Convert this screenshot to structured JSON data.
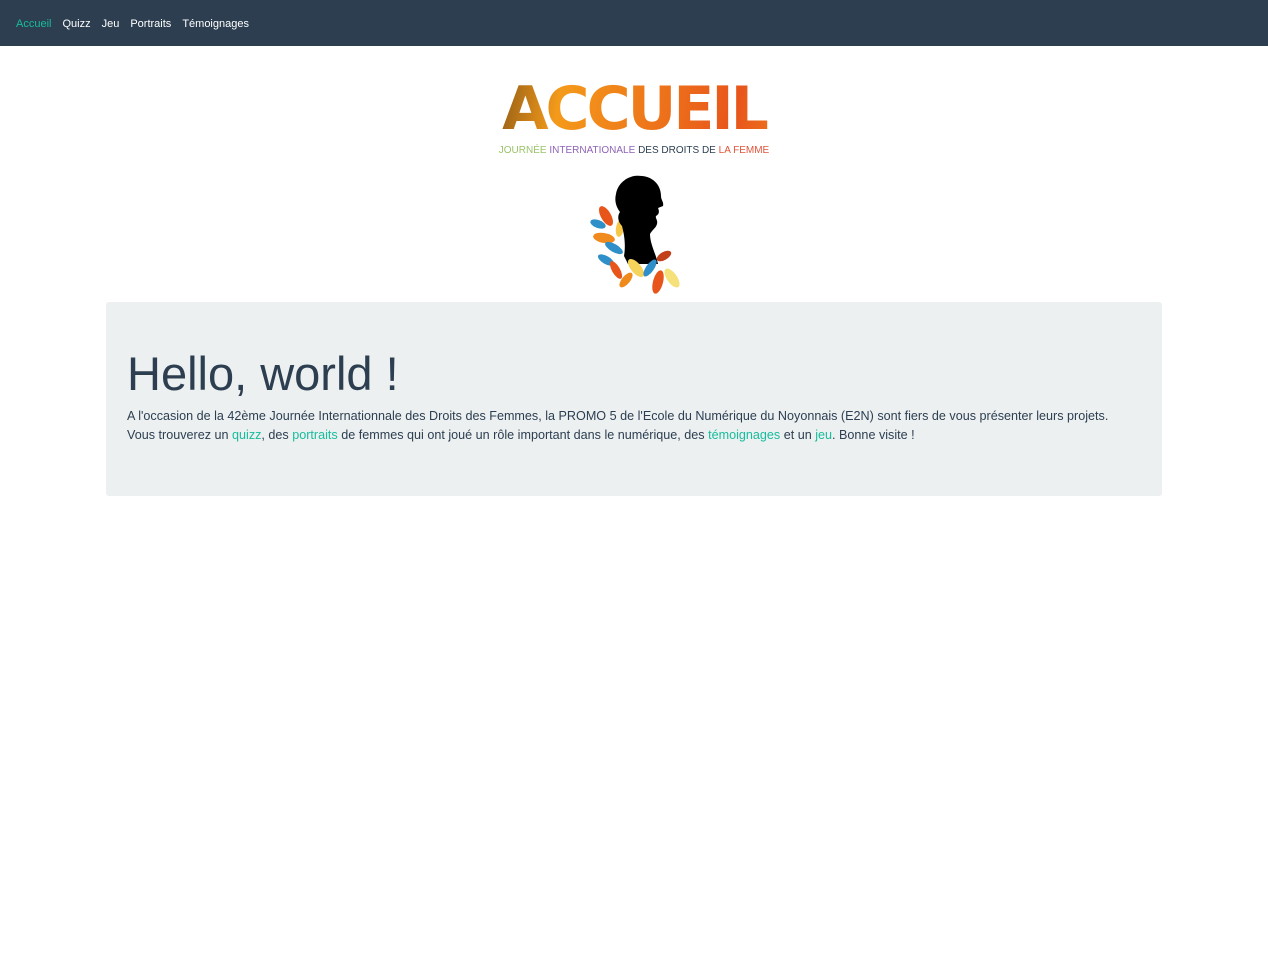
{
  "nav": {
    "items": [
      {
        "label": "Accueil"
      },
      {
        "label": "Quizz"
      },
      {
        "label": "Jeu"
      },
      {
        "label": "Portraits"
      },
      {
        "label": "Témoignages"
      }
    ],
    "active_color": "#18bc9c",
    "background": "#2c3e50"
  },
  "logo": {
    "title": "ACCUEIL",
    "subtitle": {
      "part1": "JOURNÉE ",
      "part2": "INTERNATIONALE ",
      "part3": "DES DROITS DE ",
      "part4": "LA FEMME"
    }
  },
  "jumbotron": {
    "title": "Hello, world !",
    "line1": "A l'occasion de la 42ème Journée Internationnale des Droits des Femmes, la PROMO 5 de l'Ecole du Numérique du Noyonnais (E2N) sont fiers de vous présenter leurs projets.",
    "line2_a": "Vous trouverez un ",
    "link_quizz": "quizz",
    "line2_b": ", des ",
    "link_portraits": "portraits",
    "line2_c": " de femmes qui ont joué un rôle important dans le numérique, des ",
    "link_temoignages": "témoignages",
    "line2_d": " et un ",
    "link_jeu": "jeu",
    "line2_e": ". Bonne visite !"
  },
  "colors": {
    "accent": "#18bc9c",
    "text": "#2c3e50",
    "jumbotron_bg": "#ecf0f1"
  }
}
